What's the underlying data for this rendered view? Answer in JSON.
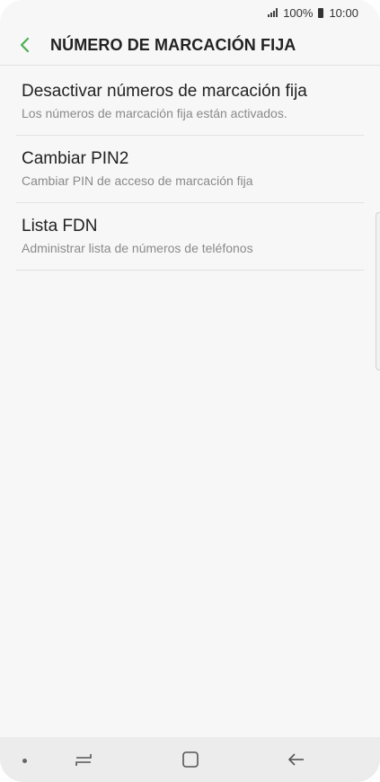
{
  "status_bar": {
    "battery_percent": "100%",
    "time": "10:00"
  },
  "header": {
    "title": "NÚMERO DE MARCACIÓN FIJA",
    "back_icon": "chevron-left-icon",
    "accent_color": "#4caf50"
  },
  "settings": {
    "items": [
      {
        "title": "Desactivar números de marcación fija",
        "subtitle": "Los números de marcación fija están activados."
      },
      {
        "title": "Cambiar PIN2",
        "subtitle": "Cambiar PIN de acceso de marcación fija"
      },
      {
        "title": "Lista FDN",
        "subtitle": "Administrar lista de números de teléfonos"
      }
    ]
  },
  "nav_bar": {
    "recent_icon": "recent-apps-icon",
    "home_icon": "home-icon",
    "back_icon": "back-arrow-icon"
  }
}
